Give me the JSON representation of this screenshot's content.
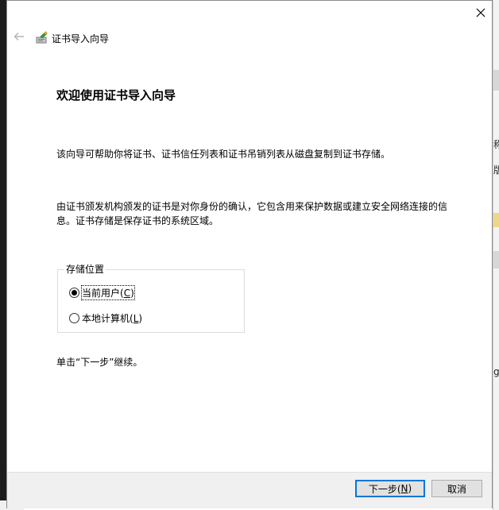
{
  "wizard": {
    "title": "证书导入向导",
    "heading": "欢迎使用证书导入向导",
    "intro": "该向导可帮助你将证书、证书信任列表和证书吊销列表从磁盘复制到证书存储。",
    "description": "由证书颁发机构颁发的证书是对你身份的确认，它包含用来保护数据或建立安全网络连接的信息。证书存储是保存证书的系统区域。",
    "store_location": {
      "label": "存储位置",
      "options": [
        {
          "label": "当前用户(",
          "accel": "C",
          "suffix": ")",
          "selected": true
        },
        {
          "label": "本地计算机(",
          "accel": "L",
          "suffix": ")",
          "selected": false
        }
      ]
    },
    "continue_hint": "单击“下一步”继续。"
  },
  "footer": {
    "next_label": "下一步(",
    "next_accel": "N",
    "next_suffix": ")",
    "cancel_label": "取消"
  },
  "background": {
    "fragments": [
      "称",
      "版",
      "gl"
    ]
  },
  "colors": {
    "accent": "#0078d7",
    "footer_bg": "#f0f0f0",
    "button_bg": "#e1e1e1"
  },
  "icons": [
    "close-icon",
    "back-arrow-icon",
    "certificate-icon"
  ]
}
